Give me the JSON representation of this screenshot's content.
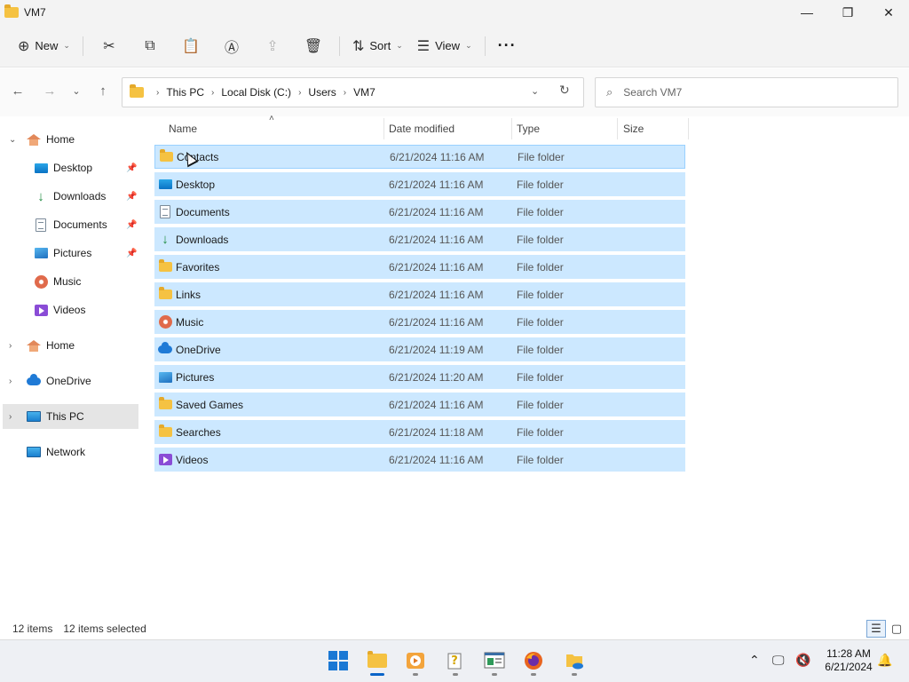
{
  "window": {
    "title": "VM7",
    "minimize": "—",
    "maximize": "❐",
    "close": "✕"
  },
  "commands": {
    "new_label": "New",
    "sort_label": "Sort",
    "view_label": "View",
    "more_label": "···"
  },
  "address": {
    "crumbs": [
      "This PC",
      "Local Disk (C:)",
      "Users",
      "VM7"
    ]
  },
  "search": {
    "placeholder": "Search VM7"
  },
  "nav": {
    "quick_access": {
      "label": "Home",
      "items": [
        {
          "label": "Desktop",
          "icon": "desktop-icon",
          "pinned": true
        },
        {
          "label": "Downloads",
          "icon": "downloads-icon",
          "pinned": true
        },
        {
          "label": "Documents",
          "icon": "documents-icon",
          "pinned": true
        },
        {
          "label": "Pictures",
          "icon": "pictures-icon",
          "pinned": true
        },
        {
          "label": "Music",
          "icon": "music-icon",
          "pinned": false
        },
        {
          "label": "Videos",
          "icon": "videos-icon",
          "pinned": false
        }
      ]
    },
    "home2": "Home",
    "onedrive": "OneDrive",
    "thispc": "This PC",
    "network": "Network"
  },
  "columns": {
    "name": "Name",
    "date": "Date modified",
    "type": "Type",
    "size": "Size"
  },
  "files": [
    {
      "name": "Contacts",
      "date": "6/21/2024 11:16 AM",
      "type": "File folder",
      "icon": "folder-icon"
    },
    {
      "name": "Desktop",
      "date": "6/21/2024 11:16 AM",
      "type": "File folder",
      "icon": "desktop-icon"
    },
    {
      "name": "Documents",
      "date": "6/21/2024 11:16 AM",
      "type": "File folder",
      "icon": "documents-icon"
    },
    {
      "name": "Downloads",
      "date": "6/21/2024 11:16 AM",
      "type": "File folder",
      "icon": "downloads-icon"
    },
    {
      "name": "Favorites",
      "date": "6/21/2024 11:16 AM",
      "type": "File folder",
      "icon": "folder-icon"
    },
    {
      "name": "Links",
      "date": "6/21/2024 11:16 AM",
      "type": "File folder",
      "icon": "folder-icon"
    },
    {
      "name": "Music",
      "date": "6/21/2024 11:16 AM",
      "type": "File folder",
      "icon": "music-icon"
    },
    {
      "name": "OneDrive",
      "date": "6/21/2024 11:19 AM",
      "type": "File folder",
      "icon": "onedrive-icon"
    },
    {
      "name": "Pictures",
      "date": "6/21/2024 11:20 AM",
      "type": "File folder",
      "icon": "pictures-icon"
    },
    {
      "name": "Saved Games",
      "date": "6/21/2024 11:16 AM",
      "type": "File folder",
      "icon": "folder-icon"
    },
    {
      "name": "Searches",
      "date": "6/21/2024 11:18 AM",
      "type": "File folder",
      "icon": "folder-icon"
    },
    {
      "name": "Videos",
      "date": "6/21/2024 11:16 AM",
      "type": "File folder",
      "icon": "videos-icon"
    }
  ],
  "status": {
    "count": "12 items",
    "selected": "12 items selected"
  },
  "clock": {
    "time": "11:28 AM",
    "date": "6/21/2024"
  },
  "colors": {
    "selection": "#cce8ff",
    "selection_border": "#99d1ff",
    "accent": "#0a64c8"
  }
}
